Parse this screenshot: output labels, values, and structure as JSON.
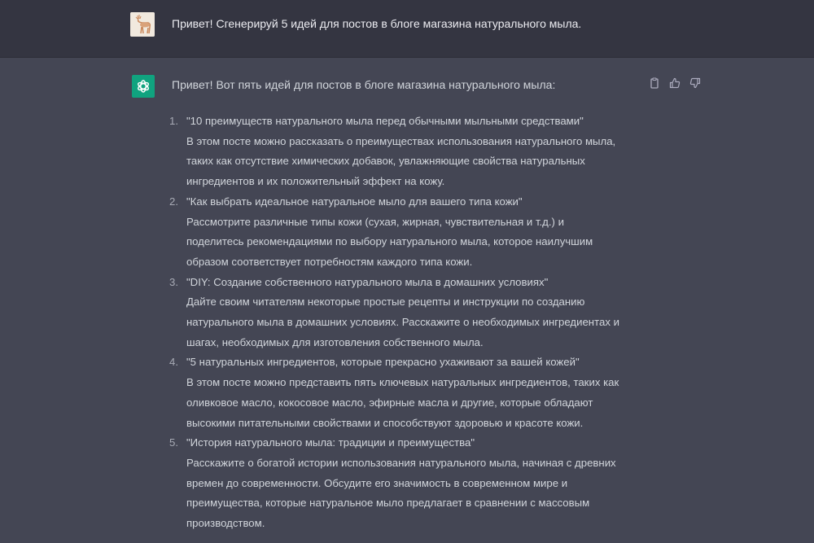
{
  "user_message": {
    "avatar": "deer-avatar",
    "text": "Привет! Сгенерируй 5 идей для постов в блоге магазина натурального мыла."
  },
  "assistant_message": {
    "avatar": "openai-logo-icon",
    "accent_color": "#10a37f",
    "intro": "Привет! Вот пять идей для постов в блоге магазина натурального мыла:",
    "actions": [
      "copy-icon",
      "thumbs-up-icon",
      "thumbs-down-icon"
    ],
    "ideas": [
      {
        "number": "1.",
        "title": "\"10 преимуществ натурального мыла перед обычными мыльными средствами\"",
        "desc_lines": [
          "В этом посте можно рассказать о преимуществах использования натурального мыла,",
          "таких как отсутствие химических добавок, увлажняющие свойства натуральных",
          "ингредиентов и их положительный эффект на кожу."
        ]
      },
      {
        "number": "2.",
        "title": "\"Как выбрать идеальное натуральное мыло для вашего типа кожи\"",
        "desc_lines": [
          "Рассмотрите различные типы кожи (сухая, жирная, чувствительная и т.д.) и",
          "поделитесь рекомендациями по выбору натурального мыла, которое наилучшим",
          "образом соответствует потребностям каждого типа кожи."
        ]
      },
      {
        "number": "3.",
        "title": "\"DIY: Создание собственного натурального мыла в домашних условиях\"",
        "desc_lines": [
          "Дайте своим читателям некоторые простые рецепты и инструкции по созданию",
          "натурального мыла в домашних условиях. Расскажите о необходимых ингредиентах и",
          "шагах, необходимых для изготовления собственного мыла."
        ]
      },
      {
        "number": "4.",
        "title": "\"5 натуральных ингредиентов, которые прекрасно ухаживают за вашей кожей\"",
        "desc_lines": [
          "В этом посте можно представить пять ключевых натуральных ингредиентов, таких как",
          "оливковое масло, кокосовое масло, эфирные масла и другие, которые обладают",
          "высокими питательными свойствами и способствуют здоровью и красоте кожи."
        ]
      },
      {
        "number": "5.",
        "title": "\"История натурального мыла: традиции и преимущества\"",
        "desc_lines": [
          "Расскажите о богатой истории использования натурального мыла, начиная с древних",
          "времен до современности. Обсудите его значимость в современном мире и",
          "преимущества, которые натуральное мыло предлагает в сравнении с массовым",
          "производством."
        ]
      }
    ]
  }
}
